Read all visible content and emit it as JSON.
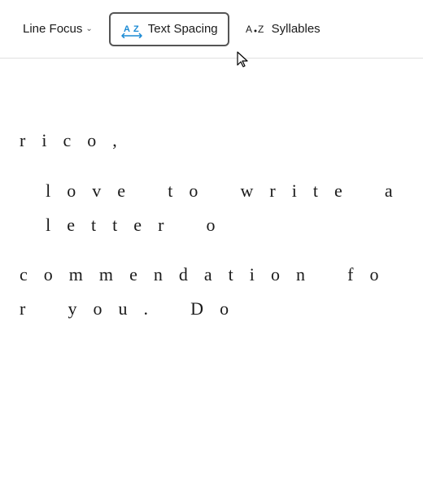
{
  "toolbar": {
    "items": [
      {
        "id": "line-focus",
        "label": "Line Focus",
        "has_chevron": true,
        "active": false
      },
      {
        "id": "text-spacing",
        "label": "Text Spacing",
        "has_chevron": false,
        "active": true
      },
      {
        "id": "syllables",
        "label": "Syllables",
        "has_chevron": false,
        "active": false
      }
    ]
  },
  "content": {
    "lines": [
      "r i c o ,",
      "",
      "  l o v e   t o   w r i t e   a   l e t t e r   o",
      "",
      "c o m m e n d a t i o n   f o r   y o u .   D o"
    ]
  }
}
